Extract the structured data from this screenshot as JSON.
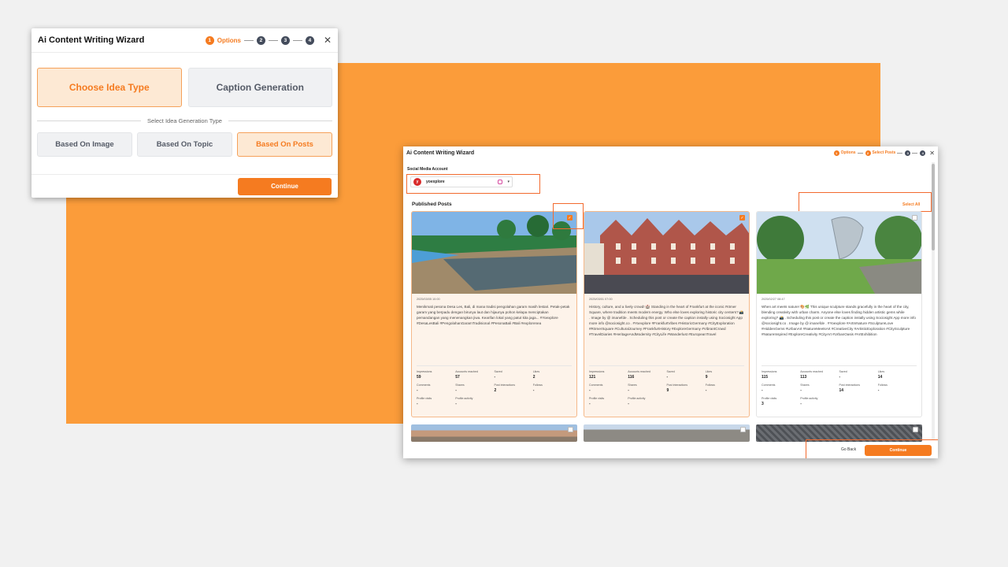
{
  "wizard1": {
    "title": "Ai Content Writing Wizard",
    "steps": [
      {
        "num": "1",
        "label": "Options"
      },
      {
        "num": "2",
        "label": ""
      },
      {
        "num": "3",
        "label": ""
      },
      {
        "num": "4",
        "label": ""
      }
    ],
    "close": "✕",
    "idea_types": [
      "Choose Idea Type",
      "Caption Generation"
    ],
    "divider_label": "Select Idea Generation Type",
    "generation_types": [
      "Based On Image",
      "Based On Topic",
      "Based On Posts"
    ],
    "continue_label": "Continue"
  },
  "wizard2": {
    "title": "Ai Content Writing Wizard",
    "steps": [
      {
        "num": "1",
        "label": "Options"
      },
      {
        "num": "2",
        "label": "Select Posts"
      },
      {
        "num": "3",
        "label": ""
      },
      {
        "num": "4",
        "label": ""
      }
    ],
    "close": "✕",
    "social_label": "Social Media Account",
    "account": {
      "name": "yoexplore",
      "avatar": "y"
    },
    "published_label": "Published Posts",
    "select_all": "Select All",
    "posts": [
      {
        "date": "2025/03/05 10:00",
        "caption": "Menikmati pesona Desa Les, Bali, di mana tradisi pengolahan garam masih lestari. Petak-petak garam yang berpadu dengan birunya laut dan hijaunya pohon kelapa menciptakan pemandangan yang menenangkan jiwa. Kearifan lokal yang patut kita jaga... #Yoexplore #DesaLesBali #PengolahanGaramTradisional #PesonaBali #Bali #explorenea",
        "stats": [
          {
            "k": "Impressions",
            "v": "59"
          },
          {
            "k": "Accounts reached",
            "v": "57"
          },
          {
            "k": "Saved",
            "v": "-"
          },
          {
            "k": "Likes",
            "v": "2"
          },
          {
            "k": "Comments",
            "v": "-"
          },
          {
            "k": "Shares",
            "v": "-"
          },
          {
            "k": "Post interactions",
            "v": "2"
          },
          {
            "k": "Follows",
            "v": "-"
          },
          {
            "k": "Profile visits",
            "v": "-"
          },
          {
            "k": "Profile activity",
            "v": "-"
          }
        ]
      },
      {
        "date": "2025/03/01 07:00",
        "caption": "History, culture, and a lively crowd! 🏰 Standing in the heart of Frankfurt at the iconic Römer Square, where tradition meets modern energy. Who else loves exploring historic city centers? 📸 . Image by @ imanefde . Scheduling this post or create the caption instally using Sociosight App more info @sociosight.co . #Yoexplore #FrankfurtVibes #HistoricGermany #CityExploration #RömerSquare #CulturalJourney #FrankfurtHistory #ExploreGermany #VibrantCrowd #TravelDiaries #HeritageAndModernity #CityLife #Wanderlust #EuropeanTravel",
        "stats": [
          {
            "k": "Impressions",
            "v": "121"
          },
          {
            "k": "Accounts reached",
            "v": "116"
          },
          {
            "k": "Saved",
            "v": "-"
          },
          {
            "k": "Likes",
            "v": "9"
          },
          {
            "k": "Comments",
            "v": "-"
          },
          {
            "k": "Shares",
            "v": "-"
          },
          {
            "k": "Post interactions",
            "v": "9"
          },
          {
            "k": "Follows",
            "v": "-"
          },
          {
            "k": "Profile visits",
            "v": "-"
          },
          {
            "k": "Profile activity",
            "v": "-"
          }
        ]
      },
      {
        "date": "2025/02/27 08:47",
        "caption": "When art meets nature! 🎨🌿 This unique sculpture stands gracefully in the heart of the city, blending creativity with urban charm. Anyone else loves finding hidden artistic gems while exploring? 📸 . Scheduling this post or create the caption instally using Sociosight App more info @sociosight.co . Image by @ imanefde . #Yoexplore #ArtInNature #SculptureLove #HiddenGems #UrbanArt #NatureMeetsArt #CreativeCity #ArtisticExploration #CitySculpture #NatureInspired #ExploreCreativity #CityArt #UrbanOasis #ArtExhibition",
        "stats": [
          {
            "k": "Impressions",
            "v": "115"
          },
          {
            "k": "Accounts reached",
            "v": "113"
          },
          {
            "k": "Saved",
            "v": "-"
          },
          {
            "k": "Likes",
            "v": "14"
          },
          {
            "k": "Comments",
            "v": "-"
          },
          {
            "k": "Shares",
            "v": "-"
          },
          {
            "k": "Post interactions",
            "v": "14"
          },
          {
            "k": "Follows",
            "v": "-"
          },
          {
            "k": "Profile visits",
            "v": "3"
          },
          {
            "k": "Profile activity",
            "v": "-"
          }
        ]
      }
    ],
    "go_back": "Go Back",
    "continue_label": "Continue"
  },
  "colors": {
    "accent": "#f57b20",
    "background_accent": "#fb9c3a",
    "highlight": "#f26a2e"
  }
}
